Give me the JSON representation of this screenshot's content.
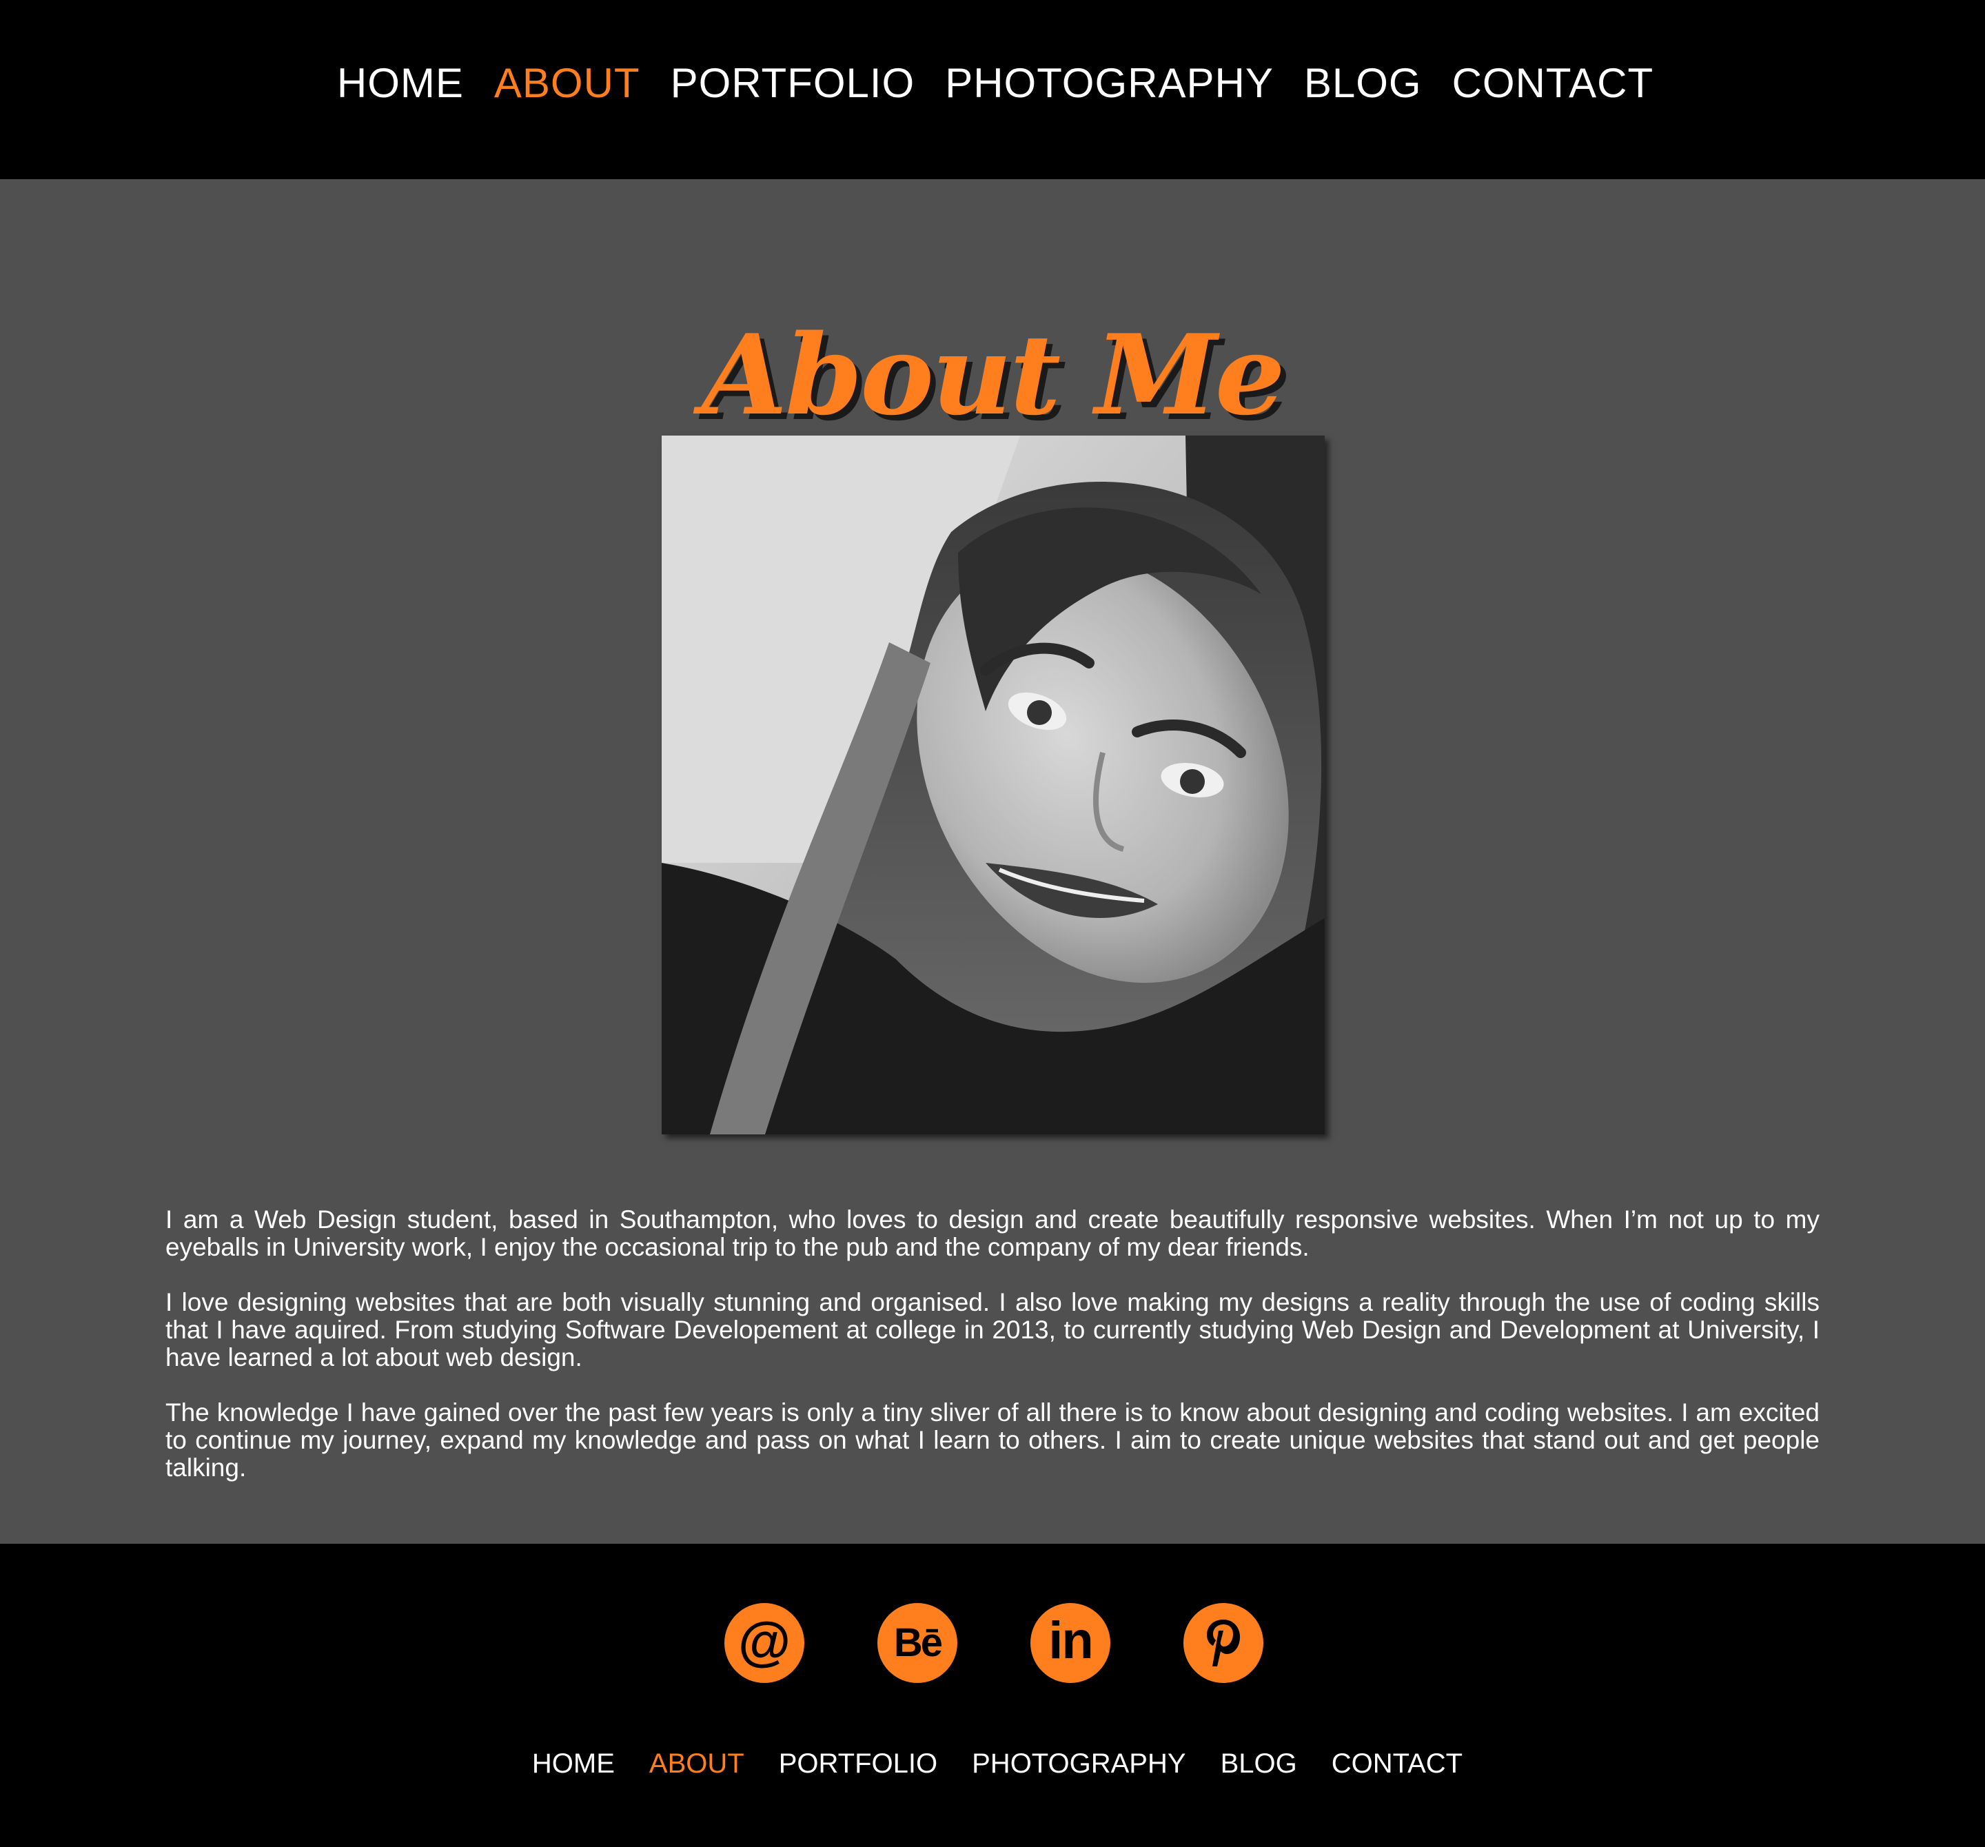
{
  "nav": {
    "items": [
      {
        "label": "HOME"
      },
      {
        "label": "ABOUT"
      },
      {
        "label": "PORTFOLIO"
      },
      {
        "label": "PHOTOGRAPHY"
      },
      {
        "label": "BLOG"
      },
      {
        "label": "CONTACT"
      }
    ],
    "active": "ABOUT"
  },
  "main": {
    "title": "About Me",
    "photo": {
      "icon": "portrait-photo",
      "style": "black-and-white"
    },
    "paragraphs": [
      "I am a Web Design student, based in Southampton, who loves to design and create beautifully responsive websites. When I’m not up to my eyeballs in University work, I enjoy the occasional trip to the pub and the company of my dear friends.",
      "I love designing websites that are both visually stunning and organised. I also love making my designs a reality through the use of coding skills that I have aquired. From studying Software Developement at college in 2013, to currently studying Web Design and Development at University, I have learned a lot about web design.",
      "The knowledge I have gained over the past few years is only a tiny sliver of all there is to know about designing and coding websites. I am excited to continue my journey, expand my knowledge and pass on what I learn to others. I aim to create unique websites that stand out and get people talking."
    ]
  },
  "footer": {
    "social": [
      {
        "icon": "email-icon",
        "glyph": "@"
      },
      {
        "icon": "behance-icon",
        "glyph": "Bē"
      },
      {
        "icon": "linkedin-icon",
        "glyph": "in"
      },
      {
        "icon": "pinterest-icon",
        "glyph": "p"
      }
    ],
    "nav": [
      {
        "label": "HOME"
      },
      {
        "label": "ABOUT"
      },
      {
        "label": "PORTFOLIO"
      },
      {
        "label": "PHOTOGRAPHY"
      },
      {
        "label": "BLOG"
      },
      {
        "label": "CONTACT"
      }
    ]
  },
  "colors": {
    "accent": "#ff7f1e",
    "header_bg": "#000000",
    "main_bg": "#505050",
    "text": "#ffffff"
  }
}
